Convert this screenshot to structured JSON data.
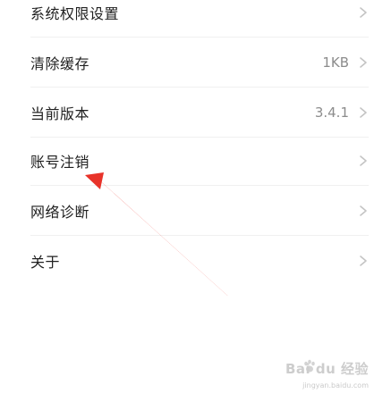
{
  "settings": {
    "items": [
      {
        "label": "系统权限设置",
        "value": ""
      },
      {
        "label": "清除缓存",
        "value": "1KB"
      },
      {
        "label": "当前版本",
        "value": "3.4.1"
      },
      {
        "label": "账号注销",
        "value": ""
      },
      {
        "label": "网络诊断",
        "value": ""
      },
      {
        "label": "关于",
        "value": ""
      }
    ]
  },
  "colors": {
    "annotation_arrow": "#e8332a",
    "chevron": "#c4c4c4",
    "divider": "#f0f0f0"
  },
  "watermark": {
    "brand": "Bai du 经验",
    "url": "jingyan.baidu.com"
  }
}
